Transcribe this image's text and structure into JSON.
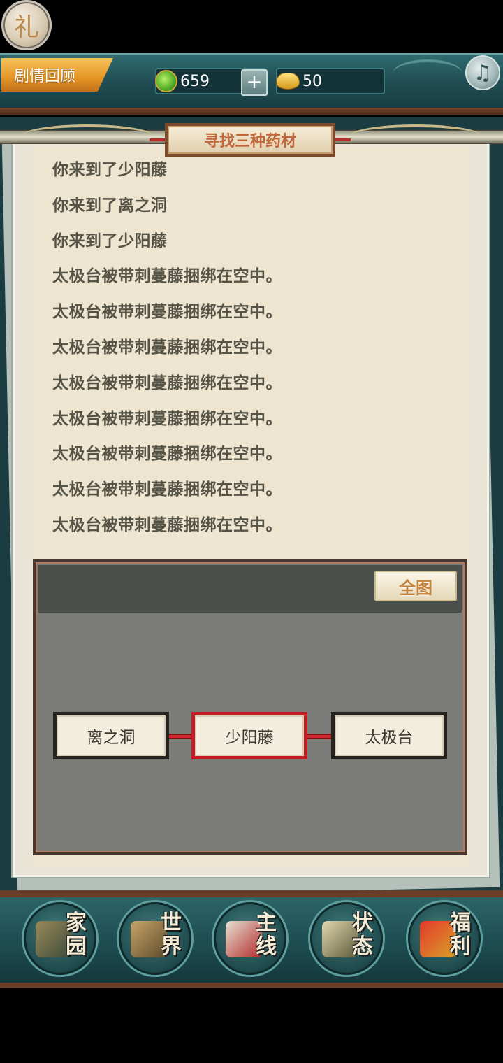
{
  "header": {
    "gift_label": "礼",
    "story_review_label": "剧情回顾",
    "jade_amount": "659",
    "plus_label": "+",
    "gold_amount": "50",
    "music_icon": "music-note-icon"
  },
  "panel": {
    "title": "寻找三种药材",
    "log": [
      "你来到了少阳藤",
      "你来到了离之洞",
      "你来到了少阳藤",
      "太极台被带刺蔓藤捆绑在空中。",
      "太极台被带刺蔓藤捆绑在空中。",
      "太极台被带刺蔓藤捆绑在空中。",
      "太极台被带刺蔓藤捆绑在空中。",
      "太极台被带刺蔓藤捆绑在空中。",
      "太极台被带刺蔓藤捆绑在空中。",
      "太极台被带刺蔓藤捆绑在空中。",
      "太极台被带刺蔓藤捆绑在空中。"
    ]
  },
  "map": {
    "full_map_label": "全图",
    "nodes": [
      "离之洞",
      "少阳藤",
      "太极台"
    ],
    "current_node": "少阳藤",
    "link_color": "#d0282c"
  },
  "nav": {
    "items": [
      {
        "label_top": "家",
        "label_bottom": "园"
      },
      {
        "label_top": "世",
        "label_bottom": "界"
      },
      {
        "label_top": "主",
        "label_bottom": "线"
      },
      {
        "label_top": "状",
        "label_bottom": "态"
      },
      {
        "label_top": "福",
        "label_bottom": "利"
      }
    ]
  }
}
